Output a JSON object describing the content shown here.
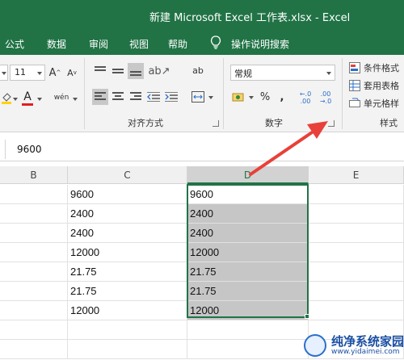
{
  "window": {
    "title": "新建 Microsoft Excel 工作表.xlsx  -  Excel"
  },
  "ribbon_tabs": [
    {
      "label": "公式"
    },
    {
      "label": "数据"
    },
    {
      "label": "审阅"
    },
    {
      "label": "视图"
    },
    {
      "label": "帮助"
    },
    {
      "label": "操作说明搜索"
    }
  ],
  "font_group": {
    "font_size": "11",
    "grow_label": "A",
    "shrink_label": "A",
    "font_color_label": "A",
    "phonetic_label": "wén"
  },
  "alignment_group": {
    "label": "对齐方式",
    "wrap_label": "ab"
  },
  "number_group": {
    "label": "数字",
    "format_value": "常规",
    "percent_label": "%",
    "comma_label": ",",
    "increase_decimal_label": "←.0 .00",
    "decrease_decimal_label": ".00 →.0"
  },
  "styles_group": {
    "label": "样式",
    "conditional_format": "条件格式",
    "format_as_table": "套用表格",
    "cell_styles": "单元格样"
  },
  "formula_bar": {
    "value": "9600"
  },
  "columns": [
    "B",
    "C",
    "D",
    "E"
  ],
  "active_column": "D",
  "rows": [
    {
      "c": "9600",
      "d": "9600"
    },
    {
      "c": "2400",
      "d": "2400"
    },
    {
      "c": "2400",
      "d": "2400"
    },
    {
      "c": "12000",
      "d": "12000"
    },
    {
      "c": "21.75",
      "d": "21.75"
    },
    {
      "c": "21.75",
      "d": "21.75"
    },
    {
      "c": "12000",
      "d": "12000"
    },
    {
      "c": "",
      "d": ""
    },
    {
      "c": "",
      "d": ""
    }
  ],
  "watermark": {
    "name": "纯净系统家园",
    "url": "www.yidaimei.com"
  },
  "colors": {
    "excel_green": "#217346",
    "annotation_arrow": "#e8403a",
    "selection_fill": "#c6c6c6"
  }
}
